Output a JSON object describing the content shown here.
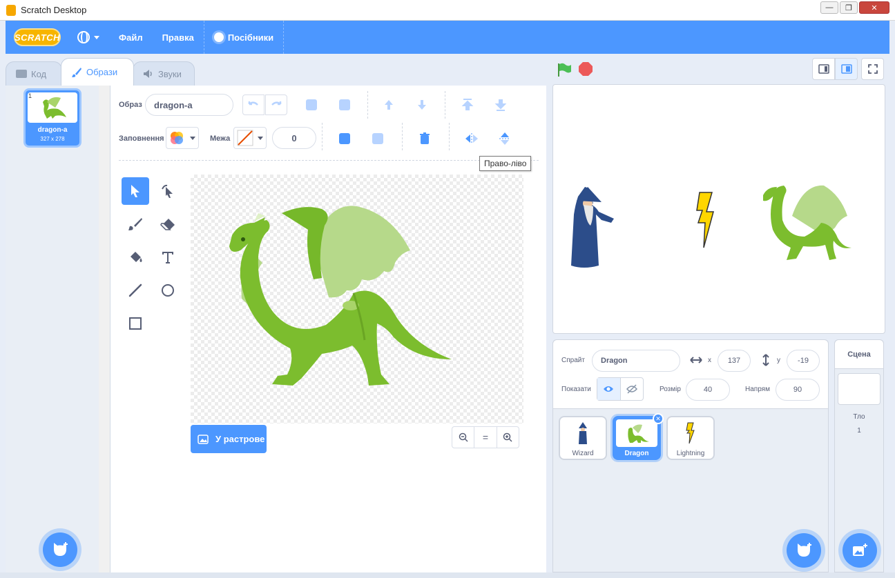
{
  "window": {
    "title": "Scratch Desktop",
    "controls": [
      "—",
      "❐",
      "✕"
    ]
  },
  "menubar": {
    "logo": "SCRATCH",
    "items": [
      "Файл",
      "Правка"
    ],
    "tutorials": "Посібники"
  },
  "tabs": [
    {
      "label": "Код",
      "icon": "code-icon"
    },
    {
      "label": "Образи",
      "icon": "brush-icon",
      "active": true
    },
    {
      "label": "Звуки",
      "icon": "speaker-icon"
    }
  ],
  "costumes": [
    {
      "number": "1",
      "name": "dragon-a",
      "size": "327 x 278"
    }
  ],
  "editor": {
    "costume_label": "Образ",
    "costume_name": "dragon-a",
    "fill_label": "Заповнення",
    "outline_label": "Межа",
    "outline_width": "0",
    "tooltip": "Право-ліво",
    "raster_button": "У растрове",
    "zoom_reset": "="
  },
  "stage": {
    "sprite_label": "Спрайт",
    "sprite_name": "Dragon",
    "x_label": "x",
    "x_value": "137",
    "y_label": "y",
    "y_value": "-19",
    "show_label": "Показати",
    "size_label": "Розмір",
    "size_value": "40",
    "direction_label": "Напрям",
    "direction_value": "90"
  },
  "sprites": [
    {
      "name": "Wizard"
    },
    {
      "name": "Dragon",
      "selected": true
    },
    {
      "name": "Lightning"
    }
  ],
  "scene": {
    "title": "Сцена",
    "backdrop_label": "Тло",
    "backdrop_count": "1"
  },
  "colors": {
    "accent": "#4c97ff",
    "dragon": "#7cbd2e",
    "lightning": "#ffd600"
  }
}
